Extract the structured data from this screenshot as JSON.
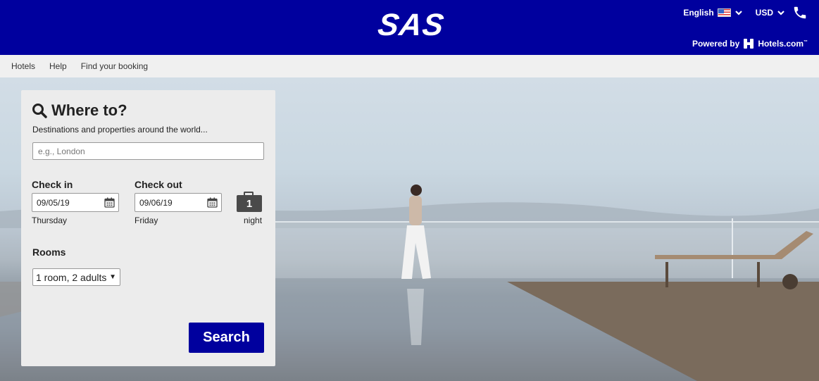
{
  "header": {
    "logo_text": "SAS",
    "language_label": "English",
    "currency_label": "USD",
    "powered_by_label": "Powered by",
    "partner_name": "Hotels.com",
    "partner_tm": "™",
    "brand_color": "#00009e",
    "icons": [
      "us-flag-icon",
      "chevron-down-icon",
      "phone-icon",
      "hotels-logo-icon"
    ]
  },
  "nav": {
    "items": [
      {
        "label": "Hotels"
      },
      {
        "label": "Help"
      },
      {
        "label": "Find your booking"
      }
    ]
  },
  "search": {
    "title": "Where to?",
    "subtitle": "Destinations and properties around the world...",
    "destination_placeholder": "e.g., London",
    "destination_value": "",
    "check_in_label": "Check in",
    "check_in_value": "09/05/19",
    "check_in_day": "Thursday",
    "check_out_label": "Check out",
    "check_out_value": "09/06/19",
    "check_out_day": "Friday",
    "nights_count": "1",
    "nights_label": "night",
    "rooms_label": "Rooms",
    "rooms_value": "1 room, 2 adults",
    "search_button": "Search"
  }
}
